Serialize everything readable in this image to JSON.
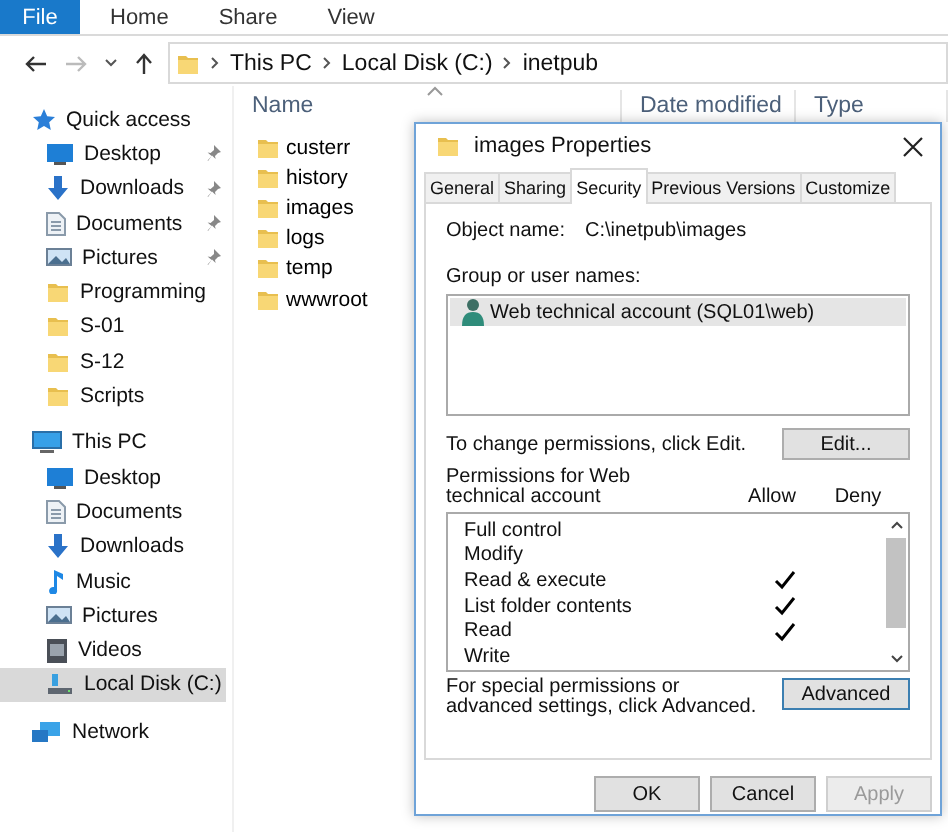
{
  "ribbon": {
    "file_button": "File",
    "tabs": [
      "Home",
      "Share",
      "View"
    ]
  },
  "address": {
    "path": [
      "This PC",
      "Local Disk (C:)",
      "inetpub"
    ]
  },
  "navigation": [
    {
      "label": "Quick access",
      "kind": "star",
      "selected": false,
      "children": [
        {
          "label": "Desktop",
          "kind": "desktop",
          "pinned": true,
          "selected": false
        },
        {
          "label": "Downloads",
          "kind": "downloads",
          "pinned": true,
          "selected": false
        },
        {
          "label": "Documents",
          "kind": "documents",
          "pinned": true,
          "selected": false
        },
        {
          "label": "Pictures",
          "kind": "pictures",
          "pinned": true,
          "selected": false
        },
        {
          "label": "Programming",
          "kind": "folder",
          "selected": false
        },
        {
          "label": "S-01",
          "kind": "folder",
          "selected": false
        },
        {
          "label": "S-12",
          "kind": "folder",
          "selected": false
        },
        {
          "label": "Scripts",
          "kind": "folder",
          "selected": false
        }
      ]
    },
    {
      "label": "This PC",
      "kind": "pc",
      "selected": false,
      "children": [
        {
          "label": "Desktop",
          "kind": "desktop",
          "selected": false
        },
        {
          "label": "Documents",
          "kind": "documents",
          "selected": false
        },
        {
          "label": "Downloads",
          "kind": "downloads",
          "selected": false
        },
        {
          "label": "Music",
          "kind": "music",
          "selected": false
        },
        {
          "label": "Pictures",
          "kind": "pictures",
          "selected": false
        },
        {
          "label": "Videos",
          "kind": "videos",
          "selected": false
        },
        {
          "label": "Local Disk (C:)",
          "kind": "disk",
          "selected": true
        }
      ]
    },
    {
      "label": "Network",
      "kind": "network",
      "selected": false
    }
  ],
  "file_list": {
    "columns": [
      "Name",
      "Date modified",
      "Type"
    ],
    "files": [
      "custerr",
      "history",
      "images",
      "logs",
      "temp",
      "wwwroot"
    ]
  },
  "dialog": {
    "title": "images Properties",
    "tabs": [
      {
        "label": "General",
        "selected": false
      },
      {
        "label": "Sharing",
        "selected": false
      },
      {
        "label": "Security",
        "selected": true
      },
      {
        "label": "Previous Versions",
        "selected": false
      },
      {
        "label": "Customize",
        "selected": false
      }
    ],
    "object_label": "Object name:",
    "object_value": "C:\\inetpub\\images",
    "group_label": "Group or user names:",
    "users": [
      {
        "name": "Web technical account (SQL01\\web)",
        "selected": true
      }
    ],
    "change_note": "To change permissions, click Edit.",
    "edit_button": "Edit...",
    "permissions_label": "Permissions for Web technical account",
    "allow_header": "Allow",
    "deny_header": "Deny",
    "permissions": [
      {
        "name": "Full control",
        "allow": false,
        "deny": false
      },
      {
        "name": "Modify",
        "allow": false,
        "deny": false
      },
      {
        "name": "Read & execute",
        "allow": true,
        "deny": false
      },
      {
        "name": "List folder contents",
        "allow": true,
        "deny": false
      },
      {
        "name": "Read",
        "allow": true,
        "deny": false
      },
      {
        "name": "Write",
        "allow": false,
        "deny": false
      }
    ],
    "special_note": "For special permissions or advanced settings, click Advanced.",
    "advanced_button": "Advanced",
    "buttons": [
      {
        "label": "OK",
        "disabled": false
      },
      {
        "label": "Cancel",
        "disabled": false
      },
      {
        "label": "Apply",
        "disabled": true
      }
    ]
  }
}
